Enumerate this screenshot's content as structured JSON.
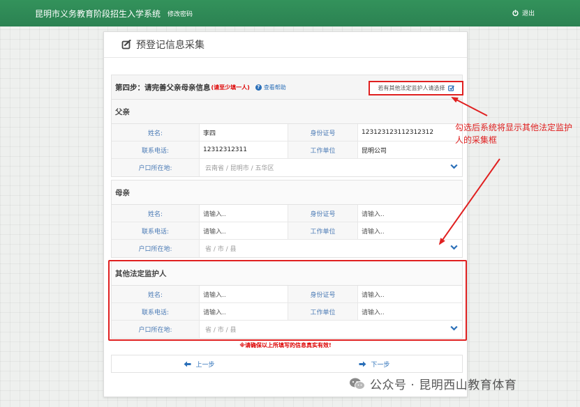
{
  "header": {
    "system_title": "昆明市义务教育阶段招生入学系统",
    "change_password": "修改密码",
    "logout": "退出"
  },
  "panel": {
    "title": "预登记信息采集"
  },
  "step": {
    "title": "第四步：请完善父亲母亲信息",
    "note": "(请至少填一人)",
    "help": "查看帮助",
    "other_guardian_checkbox": "若有其他法定监护人请选择"
  },
  "labels": {
    "name": "姓名:",
    "id_number": "身份证号",
    "phone": "联系电话:",
    "work_unit": "工作单位",
    "hukou": "户口所在地:"
  },
  "father": {
    "heading": "父亲",
    "name": "李四",
    "id_number": "123123123112312312",
    "phone": "12312312311",
    "work_unit": "昆明公司",
    "address": "云南省 /  昆明市 /  五华区"
  },
  "mother": {
    "heading": "母亲",
    "name": "请输入..",
    "id_number": "请输入..",
    "phone": "请输入..",
    "work_unit": "请输入..",
    "address": "省 /  市 /  县"
  },
  "other_guardian": {
    "heading": "其他法定监护人",
    "name": "请输入..",
    "id_number": "请输入..",
    "phone": "请输入..",
    "work_unit": "请输入..",
    "address": "省 /  市 /  县"
  },
  "warning": "※请确保以上所填写的信息真实有效!",
  "nav": {
    "prev": "上一步",
    "next": "下一步"
  },
  "annotation": "勾选后系统将显示其他法定监护人的采集框",
  "watermark": "公众号 · 昆明西山教育体育",
  "colors": {
    "header_green": "#2e8b57",
    "highlight_red": "#e02020",
    "link_blue": "#2a6fb8"
  }
}
